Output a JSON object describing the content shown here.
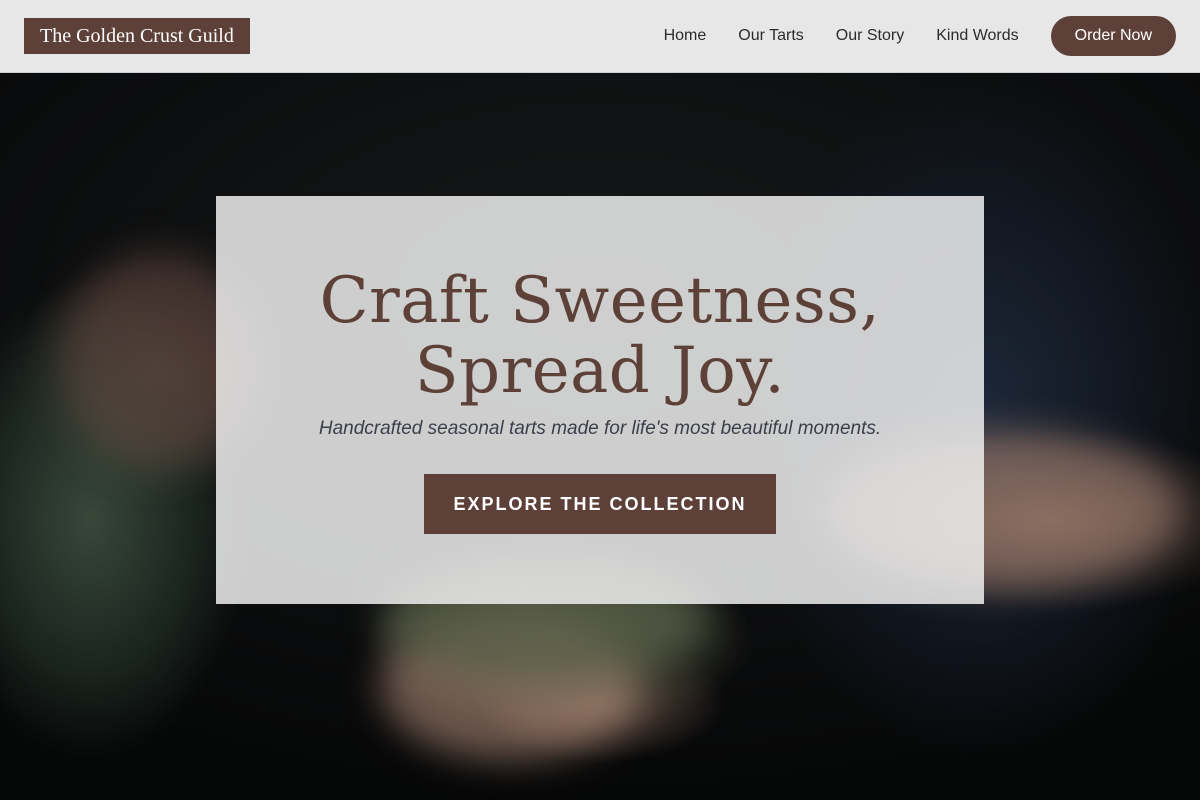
{
  "header": {
    "brand": "The Golden Crust Guild",
    "nav": [
      {
        "label": "Home"
      },
      {
        "label": "Our Tarts"
      },
      {
        "label": "Our Story"
      },
      {
        "label": "Kind Words"
      }
    ],
    "order_label": "Order Now"
  },
  "hero": {
    "title_line1": "Craft Sweetness,",
    "title_line2": "Spread Joy.",
    "subtitle": "Handcrafted seasonal tarts made for life's most beautiful moments.",
    "cta_label": "EXPLORE THE COLLECTION"
  },
  "colors": {
    "brand": "#5d4037",
    "header_bg": "#e7e7e7",
    "card_bg": "#eeeeee"
  }
}
